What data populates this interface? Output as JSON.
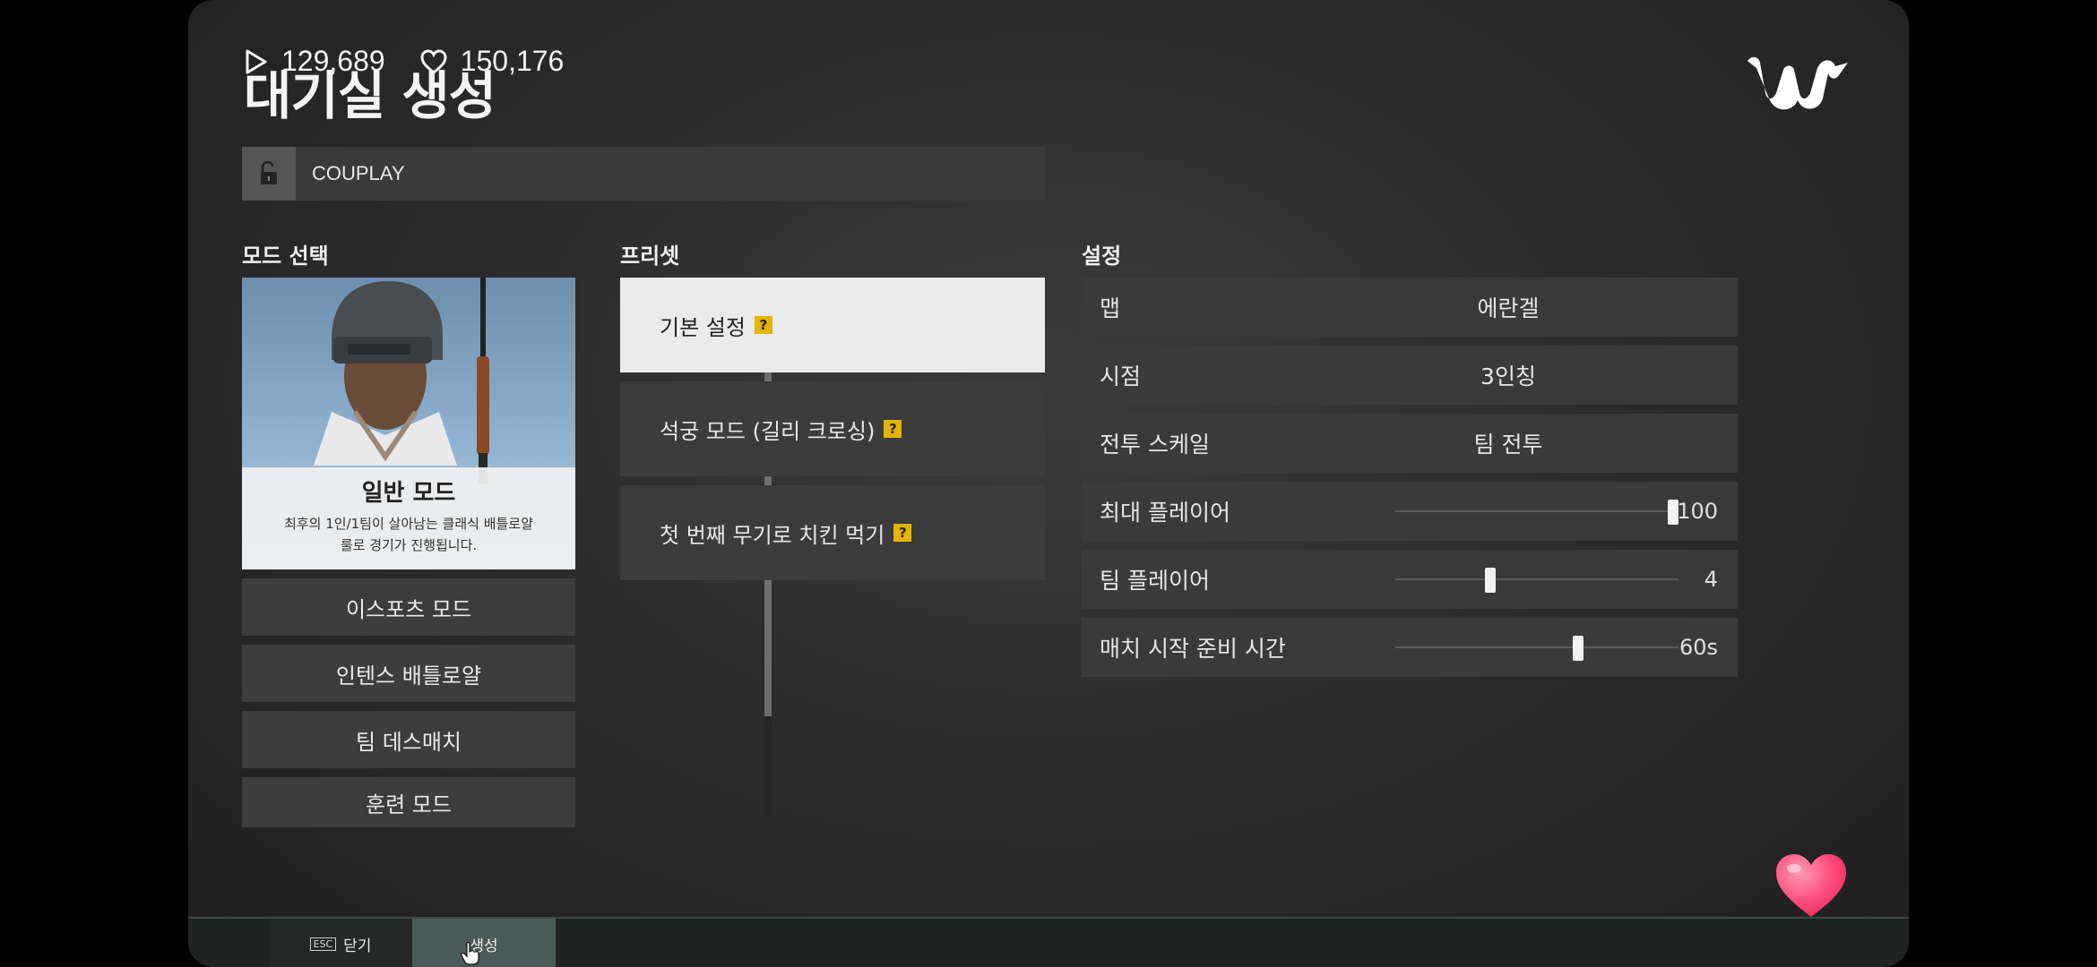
{
  "overlay": {
    "plays": "129,689",
    "likes": "150,176",
    "play_icon": "play-icon",
    "heart_icon": "heart-outline-icon"
  },
  "header": {
    "title": "대기실 생성",
    "logo": "weverse-logo"
  },
  "room": {
    "name": "COUPLAY",
    "lock_icon": "unlock-icon"
  },
  "sections": {
    "mode": "모드 선택",
    "preset": "프리셋",
    "settings": "설정"
  },
  "modes": {
    "featured": {
      "title": "일반 모드",
      "desc_line1": "최후의 1인/1팀이 살아남는 클래식 배틀로얄",
      "desc_line2": "룰로 경기가 진행됩니다."
    },
    "items": [
      "이스포츠 모드",
      "인텐스 배틀로얄",
      "팀 데스매치",
      "훈련 모드"
    ]
  },
  "presets": [
    {
      "label": "기본 설정",
      "help": "?"
    },
    {
      "label": "석궁 모드 (길리 크로싱)",
      "help": "?"
    },
    {
      "label": "첫 번째 무기로 치킨 먹기",
      "help": "?"
    }
  ],
  "settings": {
    "map": {
      "label": "맵",
      "value": "에란겔"
    },
    "view": {
      "label": "시점",
      "value": "3인칭"
    },
    "scale": {
      "label": "전투 스케일",
      "value": "팀 전투"
    },
    "max_players": {
      "label": "최대 플레이어",
      "value": "100",
      "level": 1.0
    },
    "team_players": {
      "label": "팀 플레이어",
      "value": "4",
      "level": 0.33
    },
    "ready_time": {
      "label": "매치 시작 준비 시간",
      "value": "60s",
      "level": 0.65
    }
  },
  "footer": {
    "esc": "ESC",
    "close": "닫기",
    "create": "생성"
  },
  "colors": {
    "accent": "#e4b400",
    "heart": "#ff4d7d",
    "active_preset": "#ebebeb"
  }
}
